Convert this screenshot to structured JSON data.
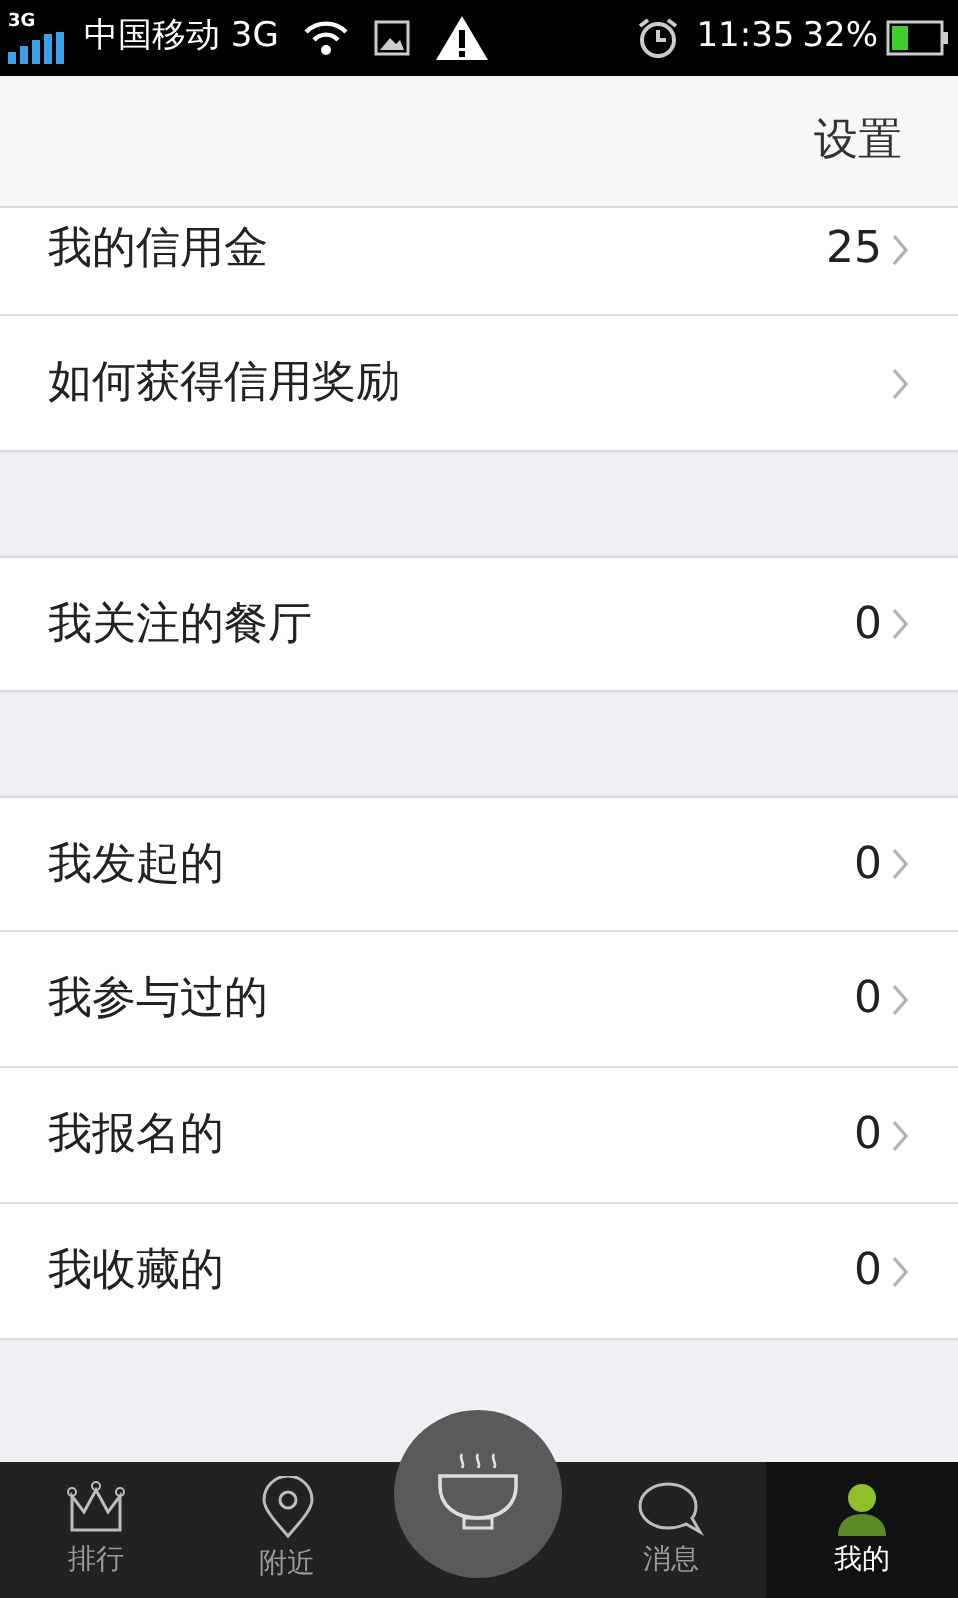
{
  "status_bar": {
    "badge": "3G",
    "carrier": "中国移动 3G",
    "time": "11:35",
    "battery": "32%"
  },
  "header": {
    "action": "设置"
  },
  "groups": [
    {
      "rows": [
        {
          "label": "我的信用金",
          "value": "25"
        },
        {
          "label": "如何获得信用奖励"
        }
      ]
    },
    {
      "rows": [
        {
          "label": "我关注的餐厅",
          "value": "0"
        }
      ]
    },
    {
      "rows": [
        {
          "label": "我发起的",
          "value": "0"
        },
        {
          "label": "我参与过的",
          "value": "0"
        },
        {
          "label": "我报名的",
          "value": "0"
        },
        {
          "label": "我收藏的",
          "value": "0"
        }
      ]
    }
  ],
  "tabs": [
    {
      "kind": "crown",
      "label": "排行",
      "selected": false
    },
    {
      "kind": "pin",
      "label": "附近",
      "selected": false
    },
    {
      "kind": "bowl",
      "selected": false
    },
    {
      "kind": "chat",
      "label": "消息",
      "selected": false
    },
    {
      "kind": "person",
      "label": "我的",
      "selected": true
    }
  ]
}
